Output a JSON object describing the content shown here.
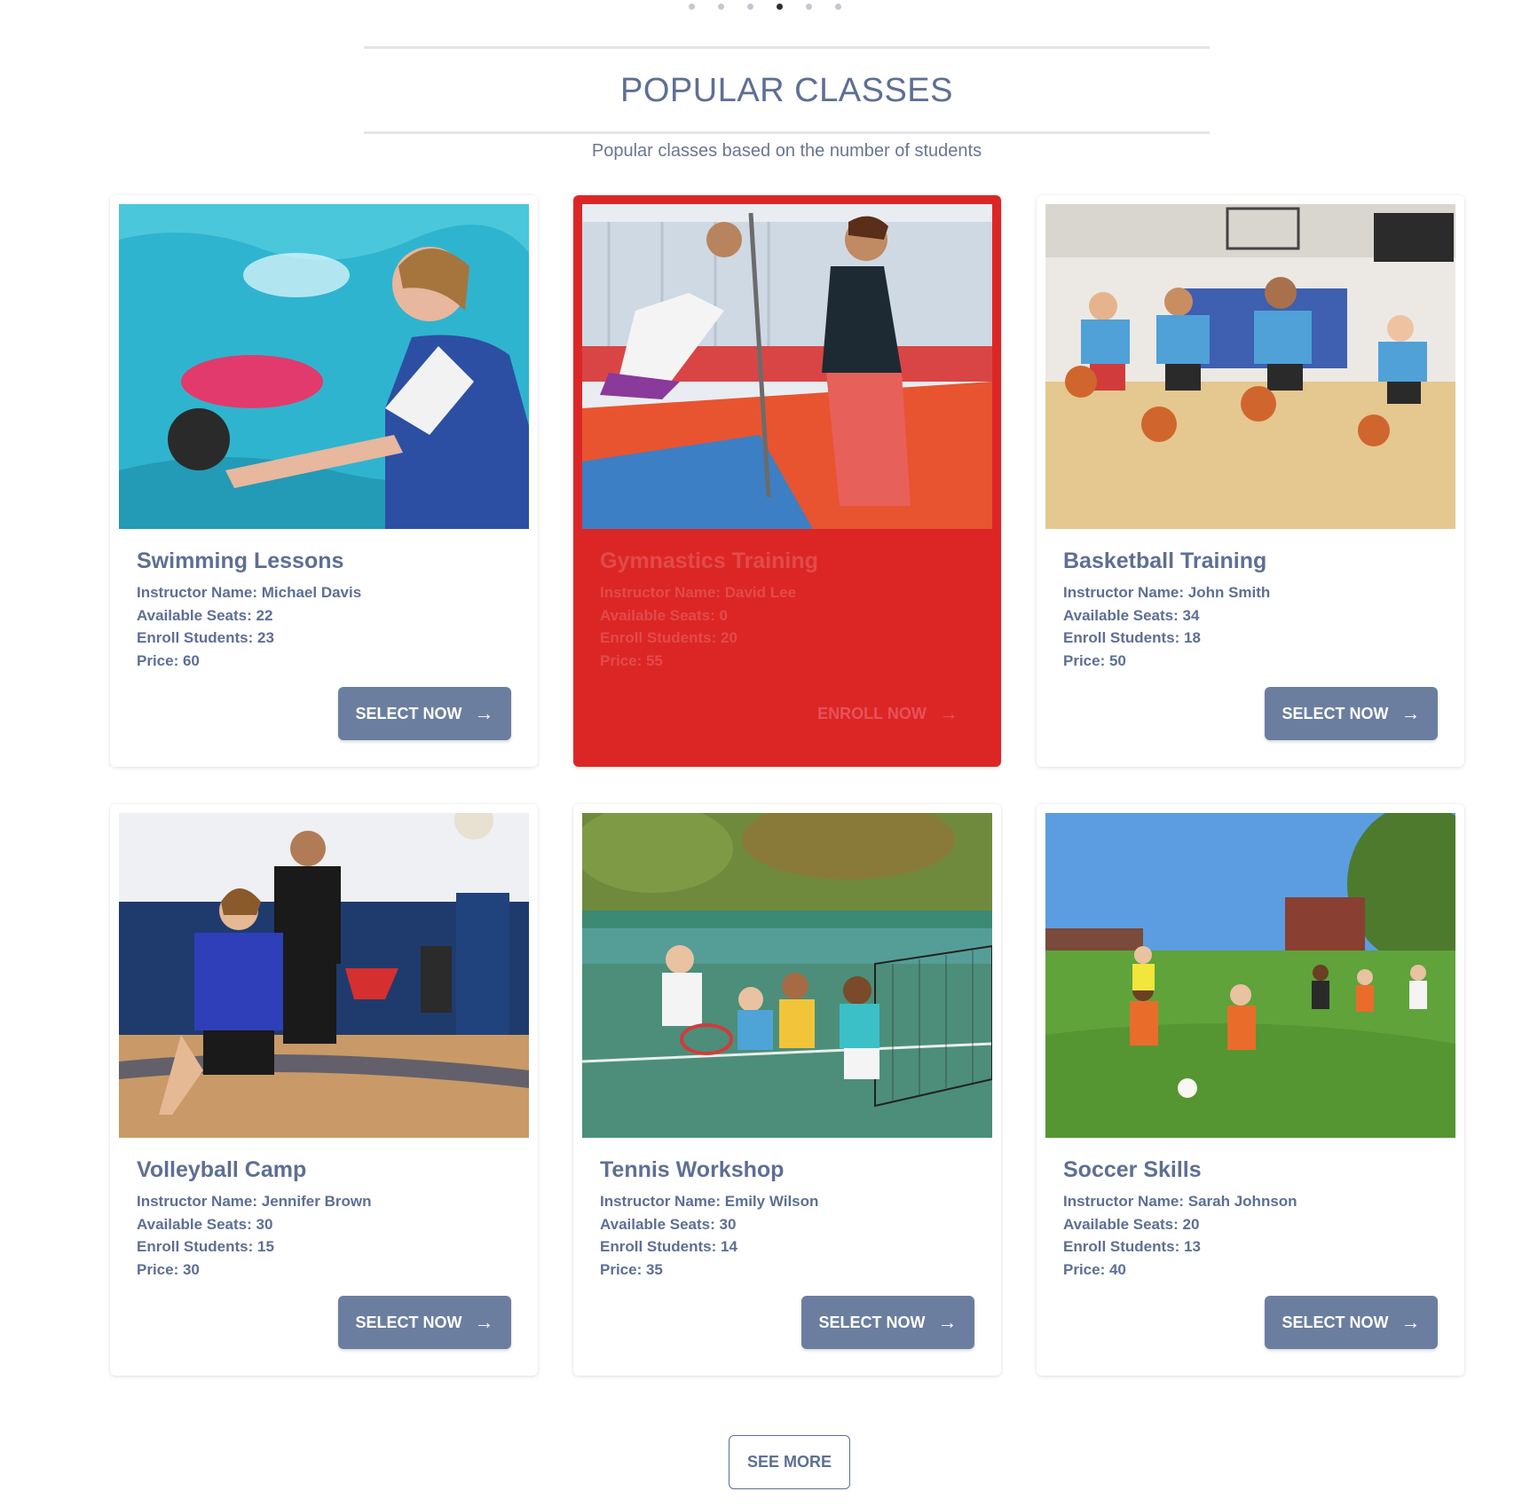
{
  "carousel": {
    "dot_count": 6,
    "active_index": 3
  },
  "header": {
    "title": "POPULAR CLASSES",
    "subtitle": "Popular classes based on the number of students"
  },
  "classes": [
    {
      "name": "Swimming Lessons",
      "instructor": "Instructor Name: Michael Davis",
      "seats": "Available Seats: 22",
      "enrolled": "Enroll Students: 23",
      "price": "Price: 60",
      "button": "SELECT NOW",
      "full": false,
      "image": "swimming-photo"
    },
    {
      "name": "Gymnastics Training",
      "instructor": "Instructor Name: David Lee",
      "seats": "Available Seats: 0",
      "enrolled": "Enroll Students: 20",
      "price": "Price: 55",
      "button": "ENROLL NOW",
      "full": true,
      "image": "gymnastics-photo"
    },
    {
      "name": "Basketball Training",
      "instructor": "Instructor Name: John Smith",
      "seats": "Available Seats: 34",
      "enrolled": "Enroll Students: 18",
      "price": "Price: 50",
      "button": "SELECT NOW",
      "full": false,
      "image": "basketball-photo"
    },
    {
      "name": "Volleyball Camp",
      "instructor": "Instructor Name: Jennifer Brown",
      "seats": "Available Seats: 30",
      "enrolled": "Enroll Students: 15",
      "price": "Price: 30",
      "button": "SELECT NOW",
      "full": false,
      "image": "volleyball-photo"
    },
    {
      "name": "Tennis Workshop",
      "instructor": "Instructor Name: Emily Wilson",
      "seats": "Available Seats: 30",
      "enrolled": "Enroll Students: 14",
      "price": "Price: 35",
      "button": "SELECT NOW",
      "full": false,
      "image": "tennis-photo"
    },
    {
      "name": "Soccer Skills",
      "instructor": "Instructor Name: Sarah Johnson",
      "seats": "Available Seats: 20",
      "enrolled": "Enroll Students: 13",
      "price": "Price: 40",
      "button": "SELECT NOW",
      "full": false,
      "image": "soccer-photo"
    }
  ],
  "see_more": "SEE MORE",
  "colors": {
    "primary": "#5d6f94",
    "button": "#6b7ea0",
    "full_card": "#dc2626"
  }
}
